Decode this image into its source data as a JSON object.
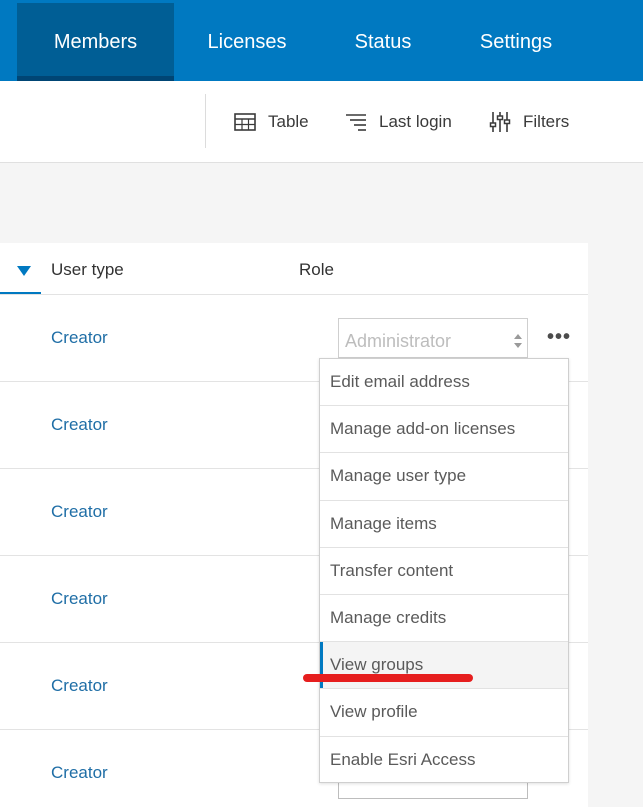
{
  "nav": {
    "tabs": [
      {
        "label": "Members",
        "active": true
      },
      {
        "label": "Licenses",
        "active": false
      },
      {
        "label": "Status",
        "active": false
      },
      {
        "label": "Settings",
        "active": false
      }
    ]
  },
  "toolbar": {
    "table_label": "Table",
    "last_login_label": "Last login",
    "filters_label": "Filters",
    "icons": [
      "table-icon",
      "sort-lines-icon",
      "filters-icon"
    ]
  },
  "table": {
    "columns": {
      "user_type": "User type",
      "role": "Role"
    },
    "rows": [
      {
        "user_type": "Creator"
      },
      {
        "user_type": "Creator"
      },
      {
        "user_type": "Creator"
      },
      {
        "user_type": "Creator"
      },
      {
        "user_type": "Creator"
      },
      {
        "user_type": "Creator"
      }
    ],
    "first_row_role": "Administrator",
    "more_label": "•••"
  },
  "menu": {
    "items": [
      "Edit email address",
      "Manage add-on licenses",
      "Manage user type",
      "Manage items",
      "Transfer content",
      "Manage credits",
      "View groups",
      "View profile",
      "Enable Esri Access"
    ],
    "active_item": "View groups"
  },
  "colors": {
    "nav_bg": "#0079c1",
    "nav_active": "#005e95",
    "accent": "#0079c1",
    "link": "#1f6ea6",
    "annotation": "#e61e1e"
  }
}
